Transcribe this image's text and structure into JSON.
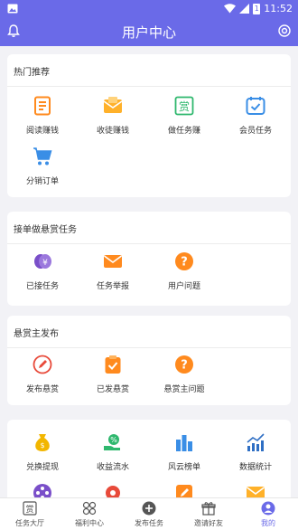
{
  "status_bar": {
    "time": "11:52",
    "battery": "1"
  },
  "header": {
    "title": "用户中心"
  },
  "sections": {
    "hot": {
      "title": "热门推荐",
      "items": [
        {
          "label": "阅读赚钱",
          "icon": "book-icon"
        },
        {
          "label": "收徒赚钱",
          "icon": "envelope-icon"
        },
        {
          "label": "做任务赚",
          "icon": "reward-icon"
        },
        {
          "label": "会员任务",
          "icon": "calendar-check-icon"
        },
        {
          "label": "分销订单",
          "icon": "cart-icon"
        }
      ]
    },
    "tasks": {
      "title": "接单做悬赏任务",
      "items": [
        {
          "label": "已接任务",
          "icon": "coins-icon"
        },
        {
          "label": "任务举报",
          "icon": "mail-icon"
        },
        {
          "label": "用户问题",
          "icon": "question-icon"
        }
      ]
    },
    "publisher": {
      "title": "悬赏主发布",
      "items": [
        {
          "label": "发布悬赏",
          "icon": "edit-icon"
        },
        {
          "label": "已发悬赏",
          "icon": "clipboard-check-icon"
        },
        {
          "label": "悬赏主问题",
          "icon": "question-icon"
        }
      ]
    },
    "tools": {
      "items": [
        {
          "label": "兑换提现",
          "icon": "money-bag-icon"
        },
        {
          "label": "收益流水",
          "icon": "income-icon"
        },
        {
          "label": "风云榜单",
          "icon": "bar-chart-icon"
        },
        {
          "label": "数据统计",
          "icon": "trend-chart-icon"
        }
      ]
    }
  },
  "bottom_nav": {
    "items": [
      {
        "label": "任务大厅",
        "icon": "reward-icon"
      },
      {
        "label": "福利中心",
        "icon": "grid-icon"
      },
      {
        "label": "发布任务",
        "icon": "add-circle-icon"
      },
      {
        "label": "邀请好友",
        "icon": "gift-icon"
      },
      {
        "label": "我的",
        "icon": "user-icon"
      }
    ],
    "active_index": 4
  },
  "colors": {
    "primary": "#6a6ae8",
    "orange": "#ff8a1e",
    "green": "#2fb86e",
    "blue": "#3a8ee6",
    "purple": "#7a4fc9",
    "red": "#e84a3a"
  }
}
